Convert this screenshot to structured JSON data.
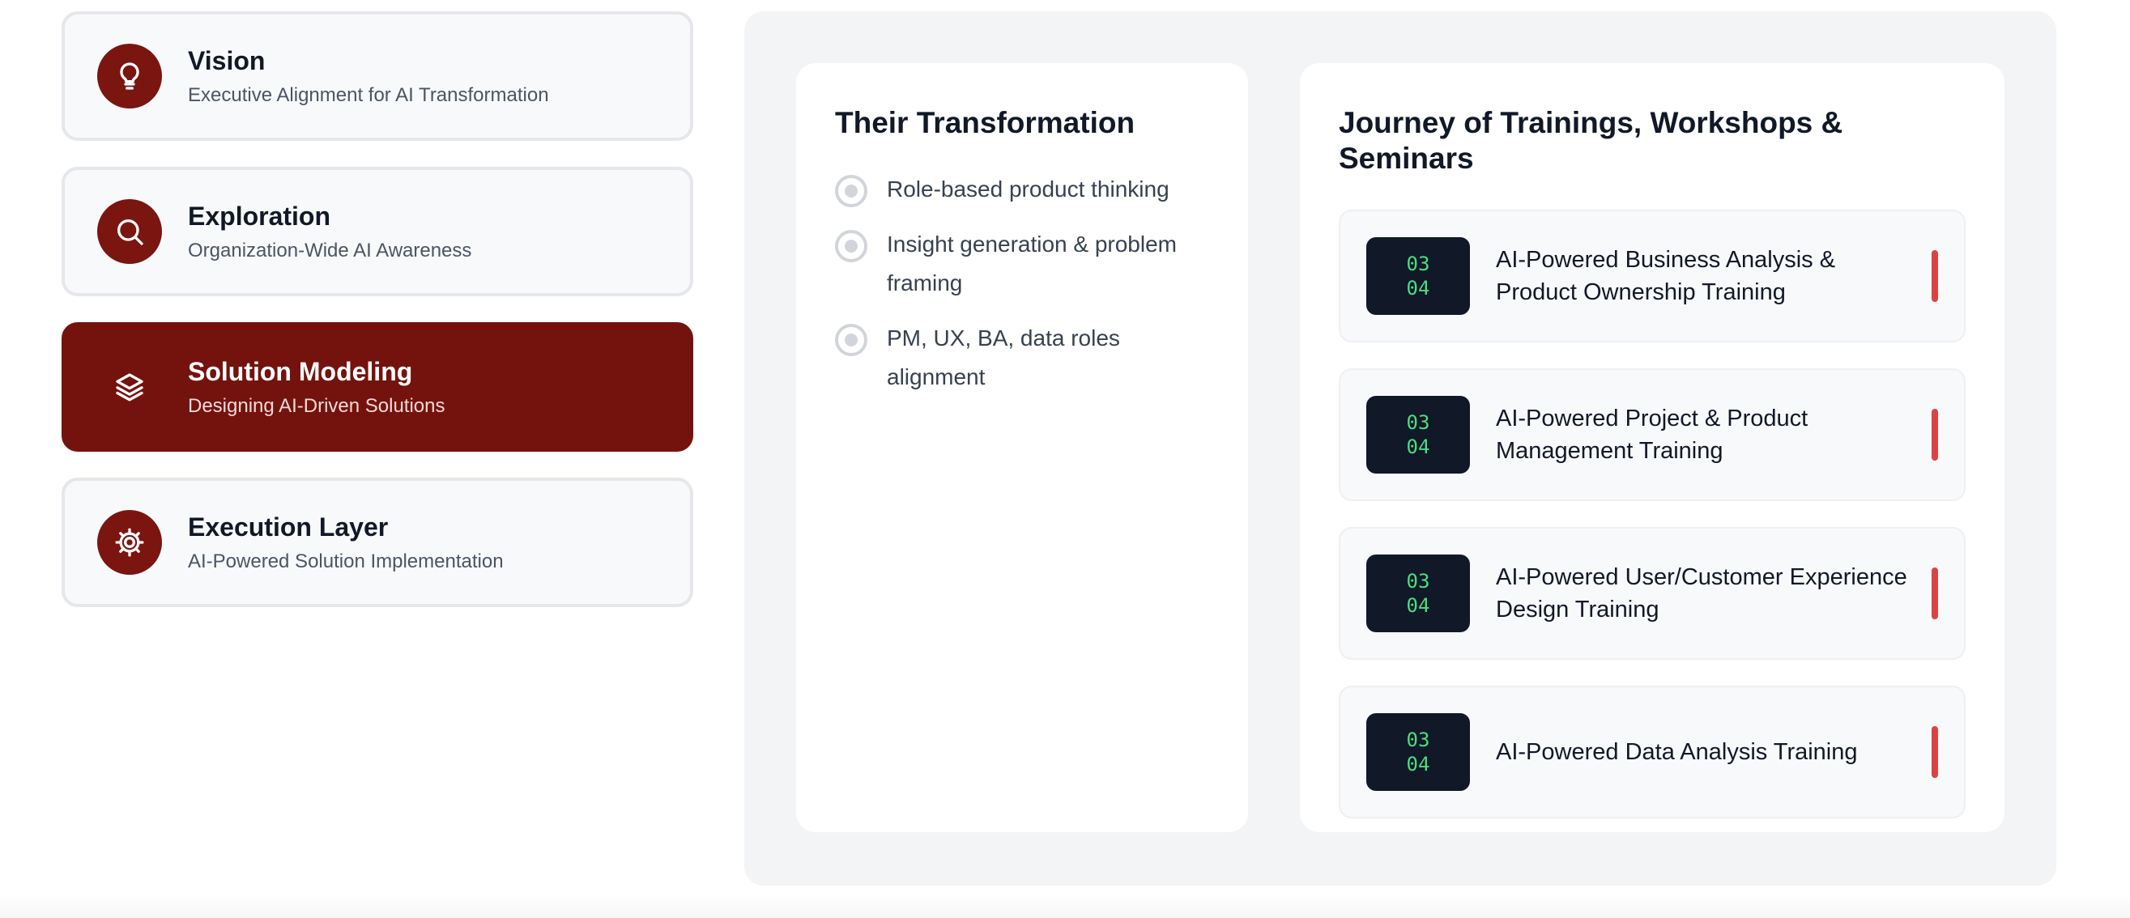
{
  "nav": {
    "items": [
      {
        "title": "Vision",
        "subtitle": "Executive Alignment for AI Transformation",
        "icon": "lightbulb-icon"
      },
      {
        "title": "Exploration",
        "subtitle": "Organization-Wide AI Awareness",
        "icon": "search-icon"
      },
      {
        "title": "Solution Modeling",
        "subtitle": "Designing AI-Driven Solutions",
        "icon": "layers-icon",
        "active": true
      },
      {
        "title": "Execution Layer",
        "subtitle": "AI-Powered Solution Implementation",
        "icon": "gear-icon"
      }
    ]
  },
  "transformation": {
    "title": "Their Transformation",
    "items": [
      "Role-based product thinking",
      "Insight generation & problem framing",
      "PM, UX, BA, data roles alignment"
    ]
  },
  "journey": {
    "title": "Journey of Trainings, Workshops & Seminars",
    "items": [
      {
        "badge_top": "03",
        "badge_bottom": "04",
        "label": "AI-Powered Business Analysis & Product Ownership Training"
      },
      {
        "badge_top": "03",
        "badge_bottom": "04",
        "label": "AI-Powered Project & Product Management Training"
      },
      {
        "badge_top": "03",
        "badge_bottom": "04",
        "label": "AI-Powered User/Customer Experience Design Training"
      },
      {
        "badge_top": "03",
        "badge_bottom": "04",
        "label": "AI-Powered Data Analysis Training"
      }
    ]
  },
  "colors": {
    "accent": "#74130e",
    "badge_bg": "#111827",
    "badge_text": "#4ade80",
    "indicator": "#dc4444"
  }
}
